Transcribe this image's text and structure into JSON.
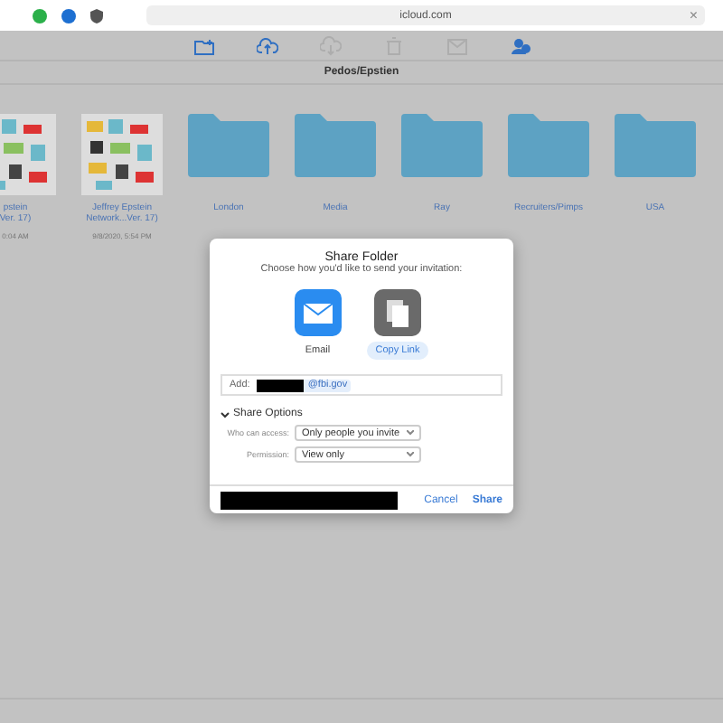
{
  "browser": {
    "url": "icloud.com",
    "close": "×"
  },
  "toolbar": {
    "buttons": [
      {
        "kind": "new-folder",
        "disabled": false
      },
      {
        "kind": "upload",
        "disabled": false
      },
      {
        "kind": "download",
        "disabled": true
      },
      {
        "kind": "delete",
        "disabled": true
      },
      {
        "kind": "mail",
        "disabled": true
      },
      {
        "kind": "share",
        "disabled": false
      }
    ]
  },
  "path_title": "Pedos/Epstien",
  "items": [
    {
      "kind": "picture",
      "name_lines": [
        "pstein",
        "Ver. 17)"
      ],
      "date": "0:04 AM"
    },
    {
      "kind": "picture",
      "name_lines": [
        "Jeffrey Epstein",
        "Network...Ver. 17)"
      ],
      "date": "9/8/2020, 5:54 PM"
    },
    {
      "kind": "folder",
      "name_lines": [
        "London"
      ]
    },
    {
      "kind": "folder",
      "name_lines": [
        "Media"
      ]
    },
    {
      "kind": "folder",
      "name_lines": [
        "Ray"
      ]
    },
    {
      "kind": "folder",
      "name_lines": [
        "Recruiters/Pimps"
      ]
    },
    {
      "kind": "folder",
      "name_lines": [
        "USA"
      ]
    }
  ],
  "dialog": {
    "title": "Share Folder",
    "subtitle": "Choose how you'd like to send your invitation:",
    "methods": [
      {
        "kind": "email",
        "label": "Email",
        "selected": false
      },
      {
        "kind": "copy",
        "label": "Copy Link",
        "selected": true
      }
    ],
    "add_label": "Add:",
    "recipient": "@fbi.gov",
    "options_header": "Share Options",
    "options_expanded": true,
    "options": [
      {
        "label": "Who can access:",
        "value": "Only people you invite"
      },
      {
        "label": "Permission:",
        "value": "View only"
      }
    ],
    "buttons": [
      {
        "label": "Cancel",
        "primary": false
      },
      {
        "label": "Share",
        "primary": true
      }
    ]
  }
}
